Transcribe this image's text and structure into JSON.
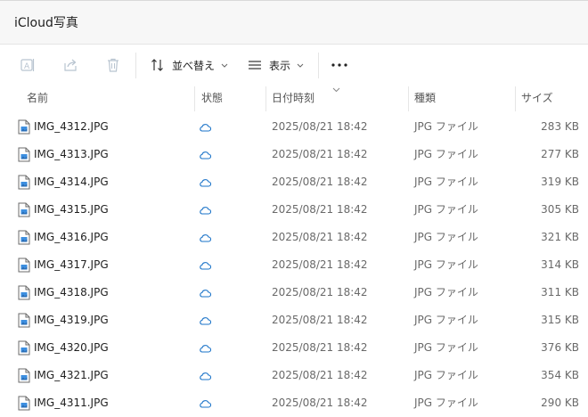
{
  "window": {
    "title": "iCloud写真"
  },
  "toolbar": {
    "sort_label": "並べ替え",
    "view_label": "表示",
    "more_label": "..."
  },
  "columns": {
    "name": "名前",
    "status": "状態",
    "date": "日付時刻",
    "type": "種類",
    "size": "サイズ"
  },
  "colors": {
    "accent": "#1a73c8",
    "cloud": "#1a73c8"
  },
  "files": [
    {
      "name": "IMG_4312.JPG",
      "date": "2025/08/21 18:42",
      "type": "JPG ファイル",
      "size": "283 KB"
    },
    {
      "name": "IMG_4313.JPG",
      "date": "2025/08/21 18:42",
      "type": "JPG ファイル",
      "size": "277 KB"
    },
    {
      "name": "IMG_4314.JPG",
      "date": "2025/08/21 18:42",
      "type": "JPG ファイル",
      "size": "319 KB"
    },
    {
      "name": "IMG_4315.JPG",
      "date": "2025/08/21 18:42",
      "type": "JPG ファイル",
      "size": "305 KB"
    },
    {
      "name": "IMG_4316.JPG",
      "date": "2025/08/21 18:42",
      "type": "JPG ファイル",
      "size": "321 KB"
    },
    {
      "name": "IMG_4317.JPG",
      "date": "2025/08/21 18:42",
      "type": "JPG ファイル",
      "size": "314 KB"
    },
    {
      "name": "IMG_4318.JPG",
      "date": "2025/08/21 18:42",
      "type": "JPG ファイル",
      "size": "311 KB"
    },
    {
      "name": "IMG_4319.JPG",
      "date": "2025/08/21 18:42",
      "type": "JPG ファイル",
      "size": "315 KB"
    },
    {
      "name": "IMG_4320.JPG",
      "date": "2025/08/21 18:42",
      "type": "JPG ファイル",
      "size": "376 KB"
    },
    {
      "name": "IMG_4321.JPG",
      "date": "2025/08/21 18:42",
      "type": "JPG ファイル",
      "size": "354 KB"
    },
    {
      "name": "IMG_4311.JPG",
      "date": "2025/08/21 18:42",
      "type": "JPG ファイル",
      "size": "290 KB"
    }
  ]
}
